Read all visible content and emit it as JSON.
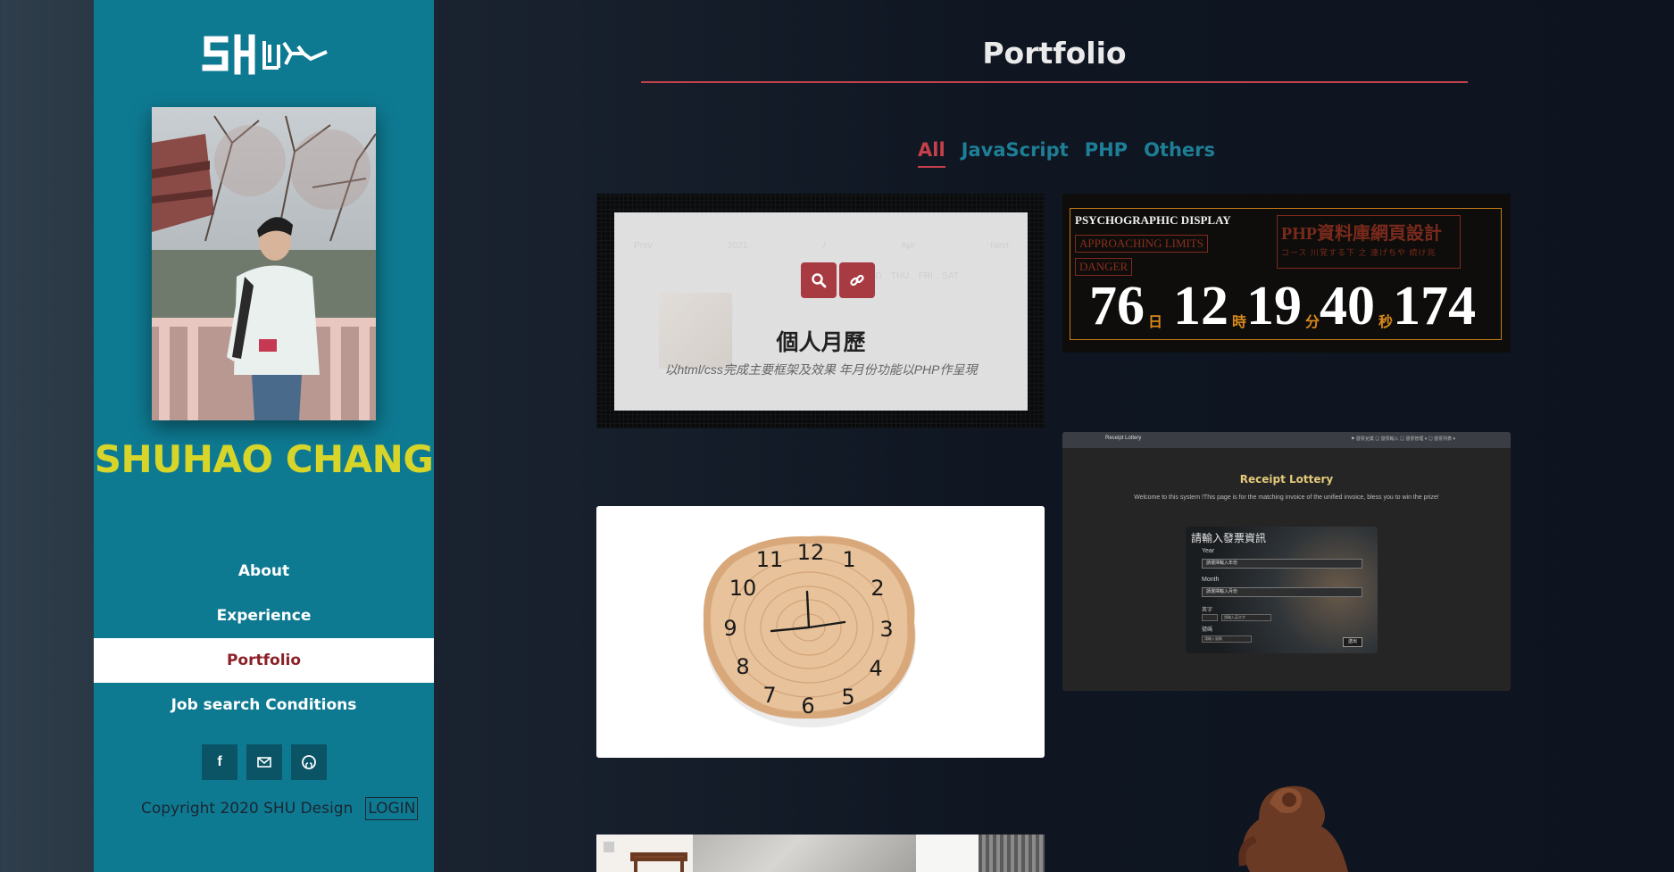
{
  "sidebar": {
    "logo_alt": "SHU",
    "name": "SHUHAO CHANG",
    "nav": [
      {
        "label": "About"
      },
      {
        "label": "Experience"
      },
      {
        "label": "Portfolio",
        "active": true
      },
      {
        "label": "Job search Conditions"
      }
    ],
    "socials": [
      {
        "icon": "facebook-icon",
        "glyph": "f"
      },
      {
        "icon": "mail-icon",
        "glyph": "✉"
      },
      {
        "icon": "github-icon",
        "glyph": "◉"
      }
    ],
    "copyright": "Copyright 2020 SHU Design",
    "login": "LOGIN"
  },
  "main": {
    "title": "Portfolio",
    "filters": [
      {
        "label": "All",
        "active": true
      },
      {
        "label": "JavaScript"
      },
      {
        "label": "PHP"
      },
      {
        "label": "Others"
      }
    ],
    "cards": {
      "calendar": {
        "title": "個人月歷",
        "description": "以html/css完成主要框架及效果 年月份功能以PHP作呈現",
        "cal_header": [
          "Prev",
          "2021",
          "/",
          "Apr",
          "Next"
        ],
        "weekdays": [
          "WED",
          "THU",
          "FRI",
          "SAT"
        ]
      },
      "countdown": {
        "heading": "PSYCHOGRAPHIC DISPLAY",
        "warn1": "APPROACHING LIMITS",
        "warn2": "DANGER",
        "php_title": "PHP資料庫網頁設計",
        "php_sub": "コース 川覚する下 之 遠げちや 続け兆",
        "days": "76",
        "days_unit": "日",
        "hours": "12",
        "hours_unit": "時",
        "minutes": "19",
        "minutes_unit": "分",
        "seconds": "40",
        "seconds_unit": "秒",
        "millis": "174"
      },
      "lottery": {
        "brand": "Receipt Lottery",
        "menu": "⚑ 發票兌獎  ▤ 發票輸入  ▤ 發票管理 ▾  ▤ 發票列表 ▾",
        "title": "Receipt Lottery",
        "subtitle": "Welcome to this system !This page is for the matching invoice of the unified invoice, bless you to win the prize!",
        "form_title": "請輸入發票資訊",
        "year_label": "Year",
        "year_value": "請選擇輸入年份",
        "month_label": "Month",
        "month_value": "請選擇輸入月份",
        "code_label": "英字",
        "code_placeholder": "請輸入英文字",
        "number_label": "號碼",
        "number_placeholder": "請輸入號碼",
        "submit": "送出"
      }
    }
  }
}
